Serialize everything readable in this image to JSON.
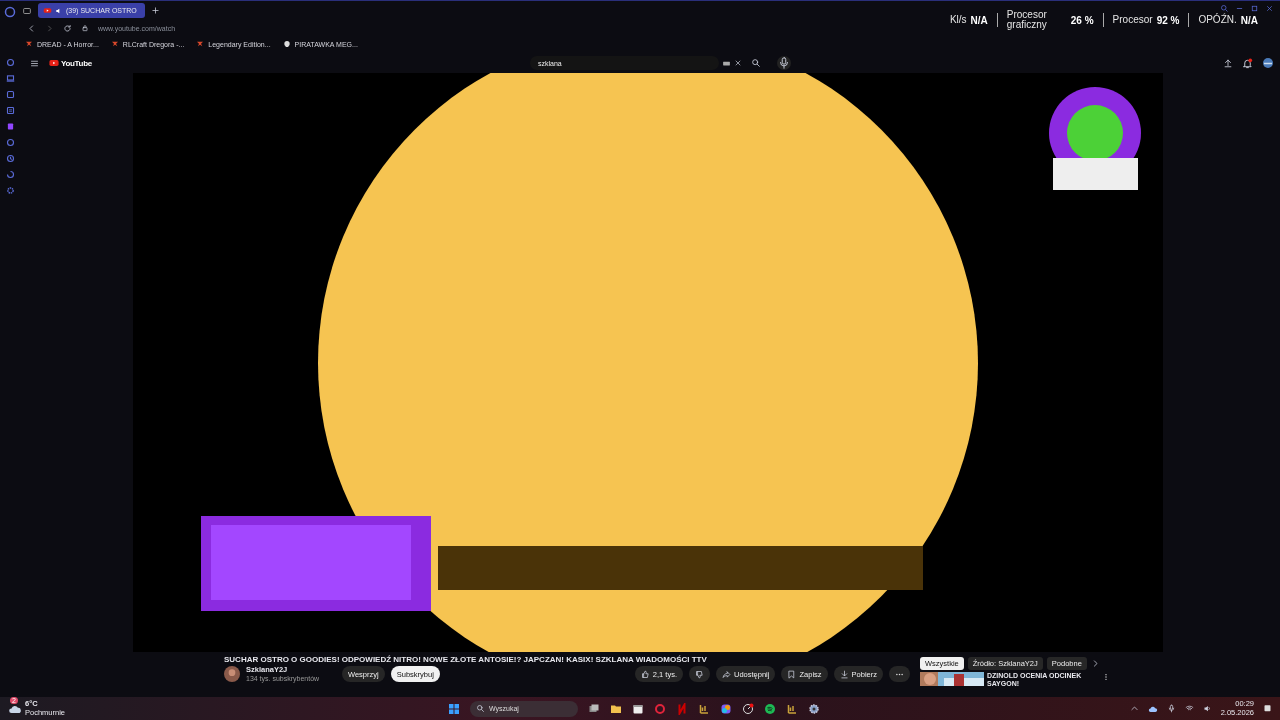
{
  "browser": {
    "tabs": [
      {
        "title": "(39) SUCHAR OSTRO",
        "selected": true
      }
    ],
    "url": "www.youtube.com/watch",
    "bookmarks": [
      {
        "label": "DREAD - A Horror...",
        "kind": "game"
      },
      {
        "label": "RLCraft Dregora -...",
        "kind": "game"
      },
      {
        "label": "Legendary Edition...",
        "kind": "game"
      },
      {
        "label": "PIRATAWKA MEG...",
        "kind": "site"
      }
    ]
  },
  "overlay": {
    "stats": [
      {
        "label": "Kl/s",
        "value": "N/A"
      },
      {
        "label": "Procesor graficzny",
        "value": "26 %"
      },
      {
        "label": "Procesor",
        "value": "92 %"
      },
      {
        "label": "OPÓŹN.",
        "value": "N/A"
      }
    ]
  },
  "youtube": {
    "logo": "YouTube",
    "search": {
      "value": "szklana"
    }
  },
  "title": "SUCHAR OSTRO O GOODIES! ODPOWIEDŹ NITRO! NOWE ZŁOTE ANTOSIE!? JAPCZAN! KASIX! SZKLANA WIADOMOŚCI TTV",
  "channel": {
    "name": "SzklanaY2J",
    "subscribers": "134 tys. subskrybentów"
  },
  "channel_buttons": [
    {
      "label": "Wesprzyj",
      "kind": "plain"
    },
    {
      "label": "Subskrybuj",
      "kind": "primary"
    }
  ],
  "actions": [
    {
      "kind": "like",
      "label": "2,1 tys."
    },
    {
      "kind": "dislike"
    },
    {
      "kind": "share",
      "label": "Udostępnij"
    },
    {
      "kind": "save",
      "label": "Zapisz"
    },
    {
      "kind": "download",
      "label": "Pobierz"
    },
    {
      "kind": "more"
    }
  ],
  "chips": [
    {
      "label": "Wszystkie",
      "selected": true
    },
    {
      "label": "Źródło: SzklanaY2J",
      "selected": false
    },
    {
      "label": "Podobne",
      "selected": false
    }
  ],
  "recommended": [
    {
      "title": "DZINOLD OCENIA ODCINEK SAYGON!"
    }
  ],
  "taskbar": {
    "weather": {
      "badge": "2",
      "temperature": "6°C",
      "condition": "Pochmurnie"
    },
    "search": {
      "placeholder": "Wyszukaj"
    },
    "clock": {
      "time": "00:29",
      "date": "2.05.2026"
    }
  }
}
